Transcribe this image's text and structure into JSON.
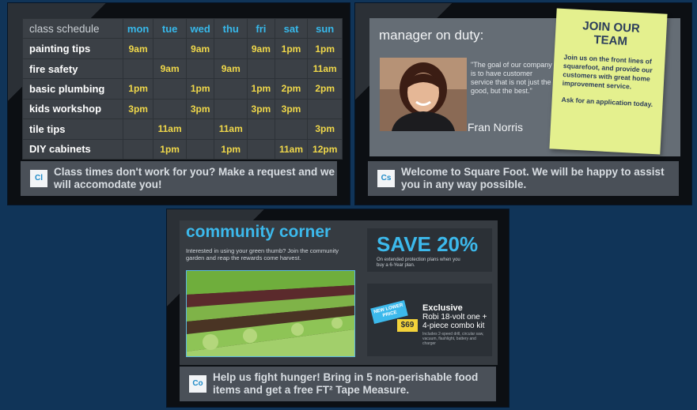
{
  "schedule": {
    "header_label": "class schedule",
    "days": [
      "mon",
      "tue",
      "wed",
      "thu",
      "fri",
      "sat",
      "sun"
    ],
    "classes": [
      {
        "name": "painting tips",
        "times": [
          "9am",
          "",
          "9am",
          "",
          "9am",
          "1pm",
          "1pm"
        ]
      },
      {
        "name": "fire safety",
        "times": [
          "",
          "9am",
          "",
          "9am",
          "",
          "",
          "11am"
        ]
      },
      {
        "name": "basic plumbing",
        "times": [
          "1pm",
          "",
          "1pm",
          "",
          "1pm",
          "2pm",
          "2pm"
        ]
      },
      {
        "name": "kids workshop",
        "times": [
          "3pm",
          "",
          "3pm",
          "",
          "3pm",
          "3pm",
          ""
        ]
      },
      {
        "name": "tile tips",
        "times": [
          "",
          "11am",
          "",
          "11am",
          "",
          "",
          "3pm"
        ]
      },
      {
        "name": "DIY cabinets",
        "times": [
          "",
          "1pm",
          "",
          "1pm",
          "",
          "11am",
          "12pm"
        ]
      }
    ],
    "footer_logo": "Cl",
    "footer_text": "Class times don't work for you? Make a request and we will accomodate you!"
  },
  "manager": {
    "heading": "manager on duty:",
    "quote": "\"The goal of our company is to have customer service that is not just the good, but the best.\"",
    "name": "Fran Norris",
    "note_title": "JOIN OUR TEAM",
    "note_body": "Join us on the front lines of squarefoot, and provide our customers with great home improvement service.",
    "note_ask": "Ask for an application today.",
    "footer_logo": "Cs",
    "footer_text": "Welcome to Square Foot. We will be happy to assist you in any way possible."
  },
  "community": {
    "title": "community corner",
    "subtitle": "Interested in using your green thumb? Join the community garden and reap the rewards come harvest.",
    "save_big": "SAVE 20%",
    "save_small": "On extended protection plans when you buy a 6-Year plan.",
    "badge": "NEW LOWER PRICE",
    "price": "$69",
    "exclusive_title": "Exclusive",
    "exclusive_desc": "Robi 18-volt one + 4-piece combo kit",
    "exclusive_fine": "Includes 2-speed drill, circular saw, vacuum, flashlight, battery and charger",
    "footer_logo": "Co",
    "footer_text": "Help us fight hunger! Bring in 5 non-perishable food items and get a free FT² Tape Measure."
  },
  "colors": {
    "background": "#103458",
    "accent_blue": "#3cb9ec",
    "time_yellow": "#f0d84a",
    "sticky_note": "#e4f08e"
  }
}
